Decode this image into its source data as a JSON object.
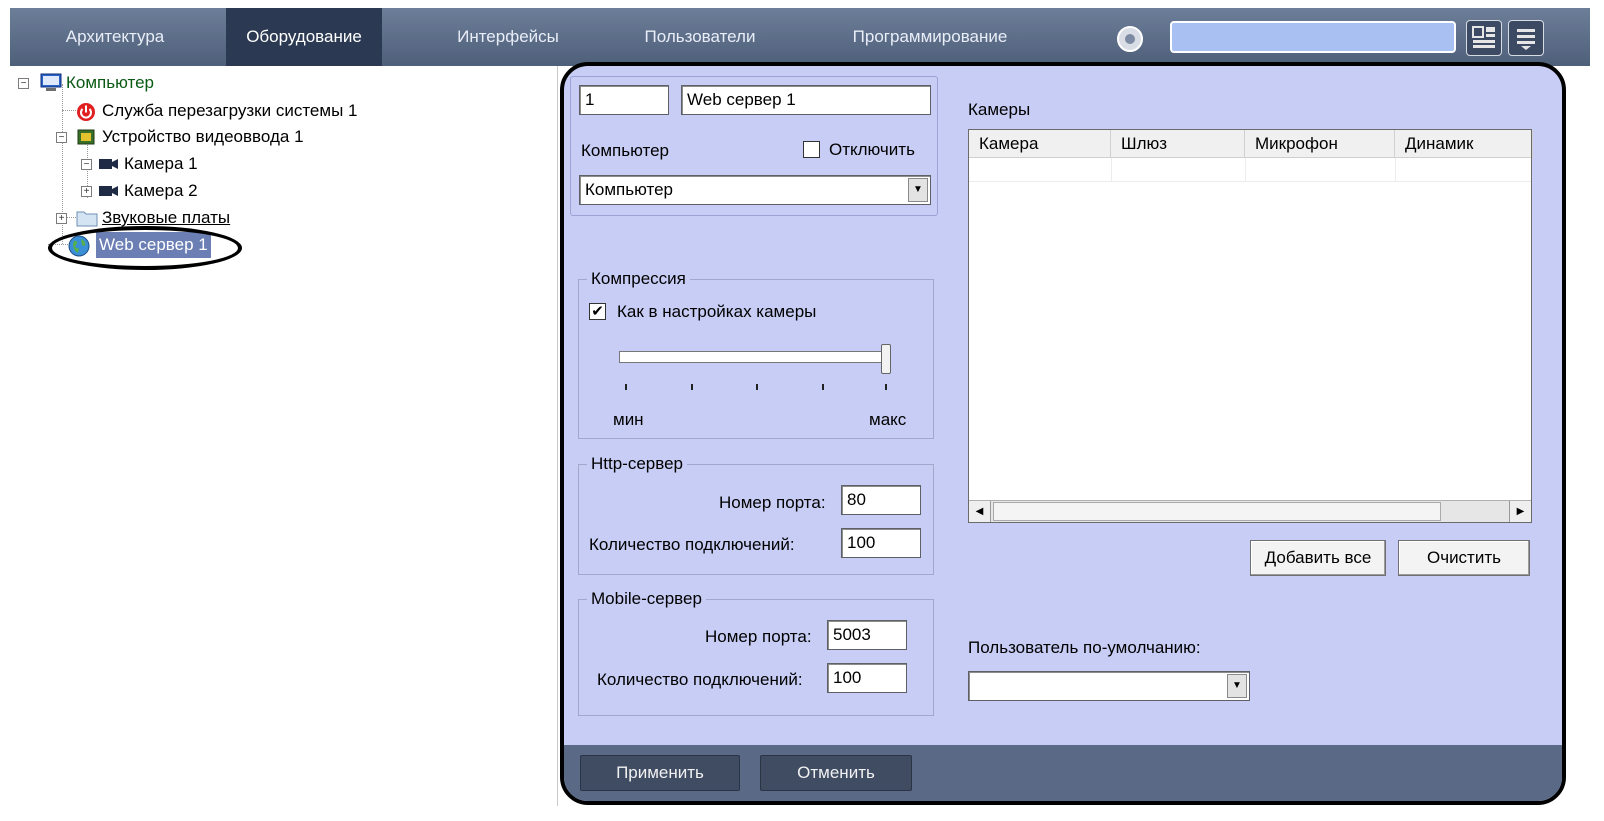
{
  "nav": {
    "tabs": [
      "Архитектура",
      "Оборудование",
      "Интерфейсы",
      "Пользователи",
      "Программирование"
    ],
    "active_tab": "Оборудование",
    "search_value": ""
  },
  "tree": {
    "computer": "Компьютер",
    "reboot_service": "Служба перезагрузки системы 1",
    "video_device": "Устройство видеоввода 1",
    "camera1": "Камера 1",
    "camera2": "Камера 2",
    "sound_cards": "Звуковые платы",
    "web_server": "Web сервер 1"
  },
  "panel": {
    "id_value": "1",
    "name_value": "Web сервер 1",
    "computer_label": "Компьютер",
    "disable_label": "Отключить",
    "disable_checked": false,
    "computer_value": "Компьютер",
    "compression": {
      "title": "Компрессия",
      "as_camera_label": "Как в настройках камеры",
      "as_camera_checked": true,
      "min_label": "мин",
      "max_label": "макс",
      "slider_level": 1.0
    },
    "http": {
      "title": "Http-сервер",
      "port_label": "Номер порта:",
      "port_value": "80",
      "conn_label": "Количество подключений:",
      "conn_value": "100"
    },
    "mobile": {
      "title": "Mobile-сервер",
      "port_label": "Номер порта:",
      "port_value": "5003",
      "conn_label": "Количество подключений:",
      "conn_value": "100"
    },
    "cameras": {
      "title": "Камеры",
      "columns": [
        "Камера",
        "Шлюз",
        "Микрофон",
        "Динамик"
      ],
      "add_all": "Добавить все",
      "clear": "Очистить"
    },
    "default_user_label": "Пользователь по-умолчанию:",
    "default_user_value": "",
    "apply": "Применить",
    "cancel": "Отменить"
  }
}
